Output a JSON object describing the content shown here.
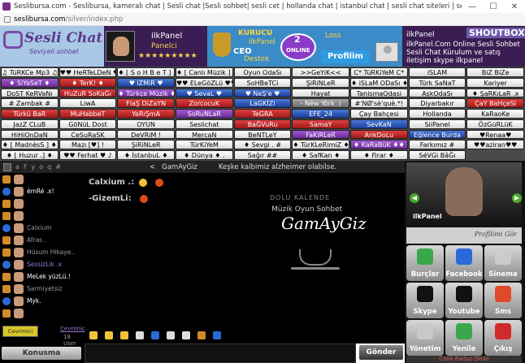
{
  "window": {
    "title": "Seslibursa.com - Seslibursa, kameralı chat | Sesli chat |Sesli sohbet| sesli cet | hollanda chat | istanbul chat | sesli chat siteleri | sesli sohbet siteleri. - Google Chrome",
    "url_host": "seslibursa.com",
    "url_path": "/silver/index.php"
  },
  "header": {
    "logo_text": "Sesli Chat",
    "logo_sub": "Seviyeli sohbet",
    "dj_name": "ilkPanel",
    "dj_role": "Panelci",
    "dj_stars": "★★★★★★★★★",
    "stage_kurucu": "KURUCU",
    "stage_ilk": "ilkPanel",
    "stage_ceo": "CEO",
    "stage_destek": "Destek",
    "online_count": "2",
    "online_label": "ONLINE",
    "loss_text": "Loss",
    "profil_label": "Profilim",
    "shoutbox_title": "SHOUTBOX",
    "shout_user": "ilkPanel",
    "shout_message": "ilkPanel.Com Online Sesli Sohbet Sesli Chat Kürulum ve satış iletişim skype ilkpanel"
  },
  "rooms": [
    "♫ TüRKCe Mp3 ♫",
    "♥♥ HeRTeLDeN ♥♥",
    "♦ [ S o H B e T ] ♦",
    "♦ [ Canlı Müzik ] ♦",
    "Oyun OdaSı",
    ">>GeYiK<<",
    "C* TüRKiYeM C*",
    "iSLAM",
    "BiZ BiZe",
    "♦ SiYaSeT ♦",
    "♦ TerK! ♦",
    "♥ iZMiR ♥",
    "♥♥ ELeGöZLü ♥♥",
    "SoHBeTCi",
    "ŞiRiNLeR",
    "♦ iSLaM ODaSı ♦",
    "Türk SaNaT",
    "Kariyer",
    "DoST KeRVaNı",
    "HuZuR SoKaĞı",
    "♦ Türkçe Müzik ♦",
    "♥ SevaL ♥",
    "♥ NeŞ'e ♥",
    "Hayat",
    "TanismaOdasi",
    "AşkOdaSı",
    "♦ ŞaRKıLaR .x",
    "# Zambak #",
    "LiwA",
    "FlaŞ DiZaYN",
    "ZorcocuK",
    "LaGKİZi",
    "- Nêw Yörk .)",
    "#'NØ'sè'què.*!",
    "Diyarbakır",
    "ÇaY BaHçeSi",
    "Türkü BaR",
    "MuHabbeT",
    "YaRıŞmA",
    "SoRuNLaR",
    "TeGRA",
    "EFE_24",
    "Çay Bahçesi",
    "Hollanda",
    "KaRaoKe",
    "JazZ CLuB",
    "GöNüL Dost",
    "OYUN",
    "Seslichat",
    "BaĞVuRu",
    "SamaY",
    "SevKaN",
    "SiiPanel",
    "ÖzGüRLüK",
    "HiHiOnDaN",
    "CeSuRaSK",
    "DeVRiM !",
    "MercaN",
    "BeNTLeY",
    "FaKiRLeR",
    "AnkDoLu",
    "Eğlence Burda",
    "♥Renaa♥",
    "♦ [ MadnèsS ] ♦",
    "Mazı [♥] !",
    "ŞiRiNLeR",
    "TürKiYeM",
    "♦ Sevgi . #",
    "♦ TürKLeRimiZ ♦",
    "♦ KaRaBüK ♦♦",
    "Farkımız #",
    "♥♥aziran♥♥",
    "♦ [ Huzur .] ♦",
    "♥♥ Ferhat ♥ ♪",
    "♦ İstanbuL ♦",
    "♦ Dünya ♦ .",
    "Sağır ##",
    "♦ SafKan ♦",
    "♦ Firar ♦",
    "SéVGi BâĞı"
  ],
  "room_styles": [
    "white",
    "white",
    "white",
    "white",
    "white",
    "white",
    "white",
    "white",
    "white",
    "purple",
    "red",
    "blue",
    "white",
    "white",
    "white",
    "white",
    "white",
    "white",
    "white",
    "red",
    "purple",
    "blue",
    "blue",
    "white",
    "white",
    "white",
    "white",
    "white",
    "white",
    "red",
    "red",
    "blue",
    "gray",
    "white",
    "white",
    "red",
    "red",
    "red",
    "red",
    "purple",
    "red",
    "blue",
    "white",
    "white",
    "white",
    "white",
    "white",
    "white",
    "white",
    "red",
    "red",
    "blue",
    "white",
    "white",
    "white",
    "white",
    "white",
    "white",
    "white",
    "purple",
    "red",
    "blue",
    "white",
    "white",
    "white",
    "white",
    "white",
    "white",
    "white",
    "purple",
    "white",
    "white",
    "white",
    "white",
    "white",
    "white",
    "white",
    "white",
    "white",
    "white",
    "white",
    "white"
  ],
  "left": {
    "toolbar": [
      "a",
      "F",
      "y",
      "o",
      "q",
      "#"
    ],
    "users": [
      {
        "name": "",
        "kind": "plain"
      },
      {
        "name": "émRé .x!",
        "kind": "white"
      },
      {
        "name": "",
        "kind": "plain"
      },
      {
        "name": "",
        "kind": "plain"
      },
      {
        "name": "Calxium",
        "kind": "plain"
      },
      {
        "name": "Afras .",
        "kind": "plain"
      },
      {
        "name": "Hüsum Hikaye..",
        "kind": "plain"
      },
      {
        "name": "SessizLik .x",
        "kind": "purple"
      },
      {
        "name": "MeLek yüzLü.!",
        "kind": "white"
      },
      {
        "name": "Sarmiyetsiz",
        "kind": "plain"
      },
      {
        "name": "Myk.",
        "kind": "white"
      },
      {
        "name": "",
        "kind": "plain"
      }
    ],
    "logo_text": "Cevrimici",
    "online_link": "Çevrimiçi",
    "online_count": "18 User",
    "konusma_label": "Konusma"
  },
  "chat": {
    "room_label": "GamAyGiz",
    "marquee": "Keşke kalbimiz alzheimer olabilse.",
    "messages": [
      {
        "user": "Calxium .:",
        "emoji": "smile"
      },
      {
        "user": "-GizemLi:",
        "emoji": "fire"
      }
    ],
    "promo_top": "DOLU KALENDE",
    "promo_sub": "Müzik Oyun Sohbet",
    "promo_logo": "GamAyGiz",
    "send_label": "Gönder"
  },
  "right": {
    "dj_label": "ilkPanel",
    "banner_text": "Profilimi Gör",
    "tiles": [
      {
        "label": "Burçlar",
        "color": "#3aa84a"
      },
      {
        "label": "Facebook",
        "color": "#2a6ad8"
      },
      {
        "label": "Sinema",
        "color": "#cccccc"
      },
      {
        "label": "Skype",
        "color": "#111111"
      },
      {
        "label": "Youtube",
        "color": "#111111"
      },
      {
        "label": "Sms",
        "color": "#e04a2a"
      },
      {
        "label": "Yönetim",
        "color": "#c8c8c8"
      },
      {
        "label": "Yenile",
        "color": "#3aa84a"
      },
      {
        "label": "Çıkış",
        "color": "#d02a2a"
      }
    ],
    "radio_text": "Canlı Radyo Dinle"
  }
}
